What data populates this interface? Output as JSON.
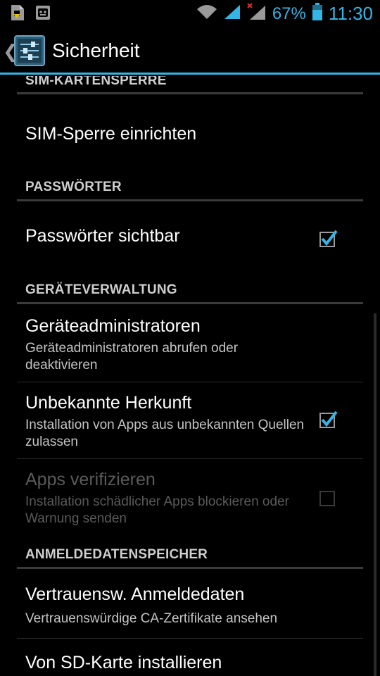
{
  "status_bar": {
    "battery_percent": "67%",
    "time": "11:30",
    "icons": [
      "download-notification-icon",
      "android-robot-icon",
      "wifi-icon",
      "signal-icon",
      "signal-no-data-icon",
      "battery-icon"
    ]
  },
  "action_bar": {
    "title": "Sicherheit",
    "icon": "settings-icon"
  },
  "sections": {
    "sim": {
      "header": "SIM-KARTENSPERRE"
    },
    "passwords": {
      "header": "PASSWÖRTER"
    },
    "device_admin": {
      "header": "GERÄTEVERWALTUNG"
    },
    "credentials": {
      "header": "ANMELDEDATENSPEICHER"
    }
  },
  "items": {
    "sim_lock": {
      "title": "SIM-Sperre einrichten"
    },
    "passwords_visible": {
      "title": "Passwörter sichtbar",
      "checked": true
    },
    "device_admins": {
      "title": "Geräteadministratoren",
      "summary": "Geräteadministratoren abrufen oder deaktivieren"
    },
    "unknown_sources": {
      "title": "Unbekannte Herkunft",
      "summary": "Installation von Apps aus unbekannten Quellen zulassen",
      "checked": true
    },
    "verify_apps": {
      "title": "Apps verifizieren",
      "summary": "Installation schädlicher Apps blockieren oder Warnung senden",
      "checked": false,
      "enabled": false
    },
    "trusted_credentials": {
      "title": "Vertrauensw. Anmeldedaten",
      "summary": "Vertrauenswürdige CA-Zertifikate ansehen"
    },
    "install_from_sd": {
      "title": "Von SD-Karte installieren"
    }
  },
  "colors": {
    "accent": "#33b5e5",
    "background": "#000000",
    "divider": "#3b3b3b"
  }
}
